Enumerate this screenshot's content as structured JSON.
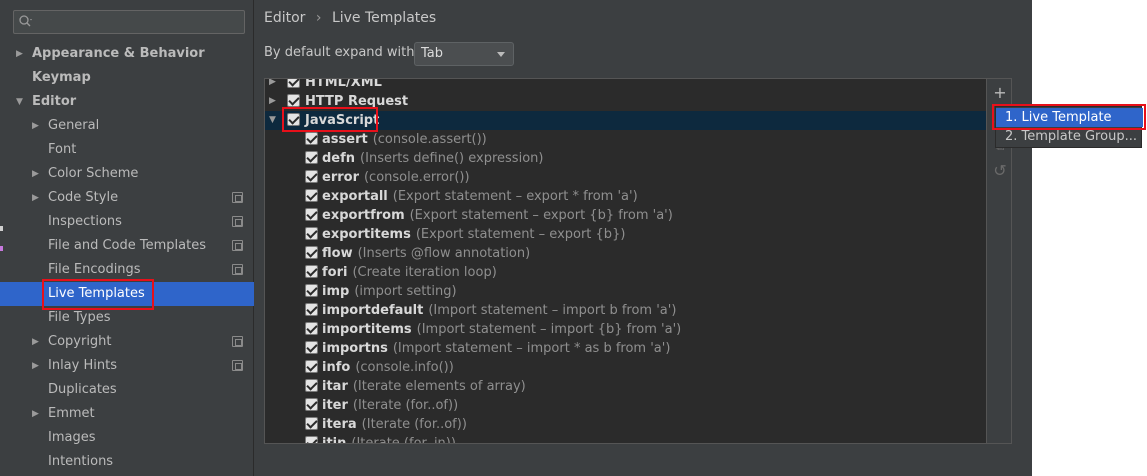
{
  "sidebar": {
    "search": {
      "placeholder": ""
    },
    "items": [
      {
        "label": "Appearance & Behavior",
        "bold": true,
        "arrow": "right"
      },
      {
        "label": "Keymap",
        "bold": true,
        "arrow": ""
      },
      {
        "label": "Editor",
        "bold": true,
        "arrow": "down"
      },
      {
        "label": "General",
        "bold": false,
        "arrow": "right"
      },
      {
        "label": "Font",
        "bold": false,
        "arrow": ""
      },
      {
        "label": "Color Scheme",
        "bold": false,
        "arrow": "right"
      },
      {
        "label": "Code Style",
        "bold": false,
        "arrow": "right",
        "project": true
      },
      {
        "label": "Inspections",
        "bold": false,
        "arrow": "",
        "project": true
      },
      {
        "label": "File and Code Templates",
        "bold": false,
        "arrow": "",
        "project": true
      },
      {
        "label": "File Encodings",
        "bold": false,
        "arrow": "",
        "project": true
      },
      {
        "label": "Live Templates",
        "bold": false,
        "arrow": "",
        "selected": true
      },
      {
        "label": "File Types",
        "bold": false,
        "arrow": ""
      },
      {
        "label": "Copyright",
        "bold": false,
        "arrow": "right",
        "project": true
      },
      {
        "label": "Inlay Hints",
        "bold": false,
        "arrow": "right",
        "project": true
      },
      {
        "label": "Duplicates",
        "bold": false,
        "arrow": ""
      },
      {
        "label": "Emmet",
        "bold": false,
        "arrow": "right"
      },
      {
        "label": "Images",
        "bold": false,
        "arrow": ""
      },
      {
        "label": "Intentions",
        "bold": false,
        "arrow": ""
      }
    ]
  },
  "breadcrumb": {
    "parent": "Editor",
    "separator": "›",
    "current": "Live Templates"
  },
  "expand": {
    "label": "By default expand with",
    "value": "Tab"
  },
  "groups": [
    {
      "name": "HTML/XML",
      "expanded": false,
      "checked": true
    },
    {
      "name": "HTTP Request",
      "expanded": false,
      "checked": true
    },
    {
      "name": "JavaScript",
      "expanded": true,
      "checked": true,
      "selected": true
    }
  ],
  "templates": [
    {
      "abbr": "assert",
      "desc": "(console.assert())"
    },
    {
      "abbr": "defn",
      "desc": "(Inserts define() expression)"
    },
    {
      "abbr": "error",
      "desc": "(console.error())"
    },
    {
      "abbr": "exportall",
      "desc": "(Export statement – export * from 'a')"
    },
    {
      "abbr": "exportfrom",
      "desc": "(Export statement – export {b} from 'a')"
    },
    {
      "abbr": "exportitems",
      "desc": "(Export statement – export {b})"
    },
    {
      "abbr": "flow",
      "desc": "(Inserts @flow annotation)"
    },
    {
      "abbr": "fori",
      "desc": "(Create iteration loop)"
    },
    {
      "abbr": "imp",
      "desc": "(import setting)"
    },
    {
      "abbr": "importdefault",
      "desc": "(Import statement – import b from 'a')"
    },
    {
      "abbr": "importitems",
      "desc": "(Import statement – import {b} from 'a')"
    },
    {
      "abbr": "importns",
      "desc": "(Import statement – import * as b from 'a')"
    },
    {
      "abbr": "info",
      "desc": "(console.info())"
    },
    {
      "abbr": "itar",
      "desc": "(Iterate elements of array)"
    },
    {
      "abbr": "iter",
      "desc": "(Iterate (for..of))"
    },
    {
      "abbr": "itera",
      "desc": "(Iterate (for..of))"
    },
    {
      "abbr": "itin",
      "desc": "(Iterate (for..in))"
    }
  ],
  "toolbar": {
    "add": "+",
    "remove": "−",
    "copy": "⧉",
    "restore": "↺"
  },
  "popup": {
    "items": [
      {
        "label": "1. Live Template",
        "active": true
      },
      {
        "label": "2. Template Group..."
      }
    ]
  },
  "colors": {
    "selection": "#2f65ca",
    "highlight_box": "#e8101a",
    "background": "#3c3f41"
  }
}
